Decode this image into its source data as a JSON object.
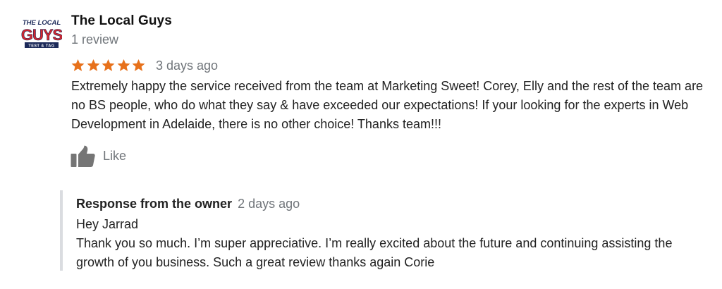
{
  "reviewer": {
    "name": "The Local Guys",
    "review_count": "1 review",
    "avatar": {
      "icon": "business-logo-icon",
      "logo_text": [
        "THE LOCAL",
        "GUYS",
        "TEST & TAG"
      ],
      "colors": {
        "primary": "#d7262e",
        "dark": "#1c2a5a"
      }
    }
  },
  "review": {
    "rating": 5,
    "max_rating": 5,
    "star_color": "#e7711b",
    "date": "3 days ago",
    "text": "Extremely happy the service received from the team at Marketing Sweet! Corey, Elly and the rest of the team are no BS people, who do what they say & have exceeded our expectations! If your looking for the experts in Web Development in Adelaide, there is no other choice! Thanks team!!!",
    "like_label": "Like",
    "like_icon": "thumbs-up-icon"
  },
  "owner_response": {
    "title": "Response from the owner",
    "date": "2 days ago",
    "greeting": "Hey Jarrad",
    "text": "Thank you so much. I’m super appreciative. I’m really excited about the future and continuing assisting the growth of you business. Such a great review thanks again Corie",
    "border_color": "#dadce0"
  }
}
